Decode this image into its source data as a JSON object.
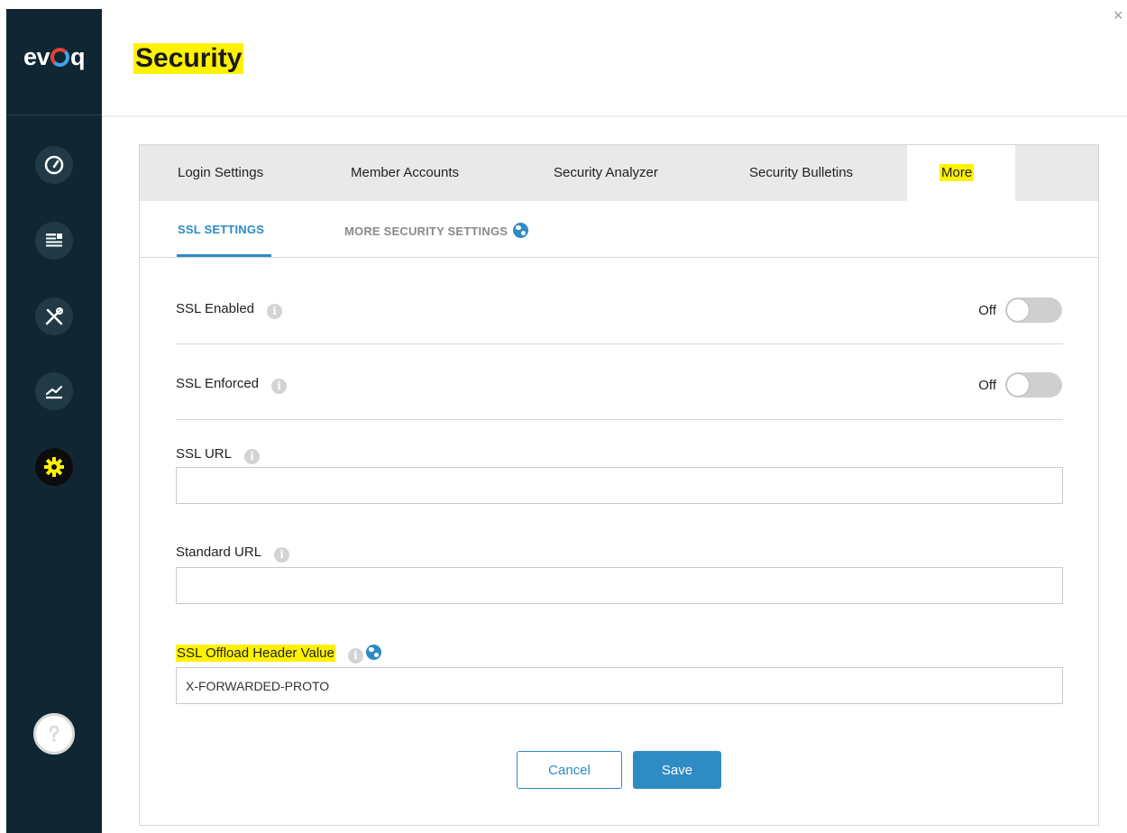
{
  "app": {
    "logo_text_pre": "ev",
    "logo_text_post": "q",
    "page_title": "Security",
    "highlight_color": "#fff200",
    "accent_color": "#2e8bc4",
    "sidebar_color": "#102733"
  },
  "sidebar": {
    "items": [
      {
        "icon": "gauge-icon"
      },
      {
        "icon": "content-icon"
      },
      {
        "icon": "tools-icon"
      },
      {
        "icon": "analytics-icon"
      },
      {
        "icon": "gear-icon",
        "active": true
      }
    ],
    "help_icon": "help-icon"
  },
  "tabs": [
    {
      "label": "Login Settings"
    },
    {
      "label": "Member Accounts"
    },
    {
      "label": "Security Analyzer"
    },
    {
      "label": "Security Bulletins"
    },
    {
      "label": "More",
      "active": true
    }
  ],
  "subtabs": [
    {
      "label": "SSL SETTINGS",
      "active": true
    },
    {
      "label": "MORE SECURITY SETTINGS"
    }
  ],
  "form": {
    "ssl_enabled": {
      "label": "SSL Enabled",
      "state": "Off"
    },
    "ssl_enforced": {
      "label": "SSL Enforced",
      "state": "Off"
    },
    "ssl_url": {
      "label": "SSL URL",
      "value": ""
    },
    "standard_url": {
      "label": "Standard URL",
      "value": ""
    },
    "ssl_offload": {
      "label": "SSL Offload Header Value",
      "value": "X-FORWARDED-PROTO"
    }
  },
  "buttons": {
    "cancel": "Cancel",
    "save": "Save"
  }
}
